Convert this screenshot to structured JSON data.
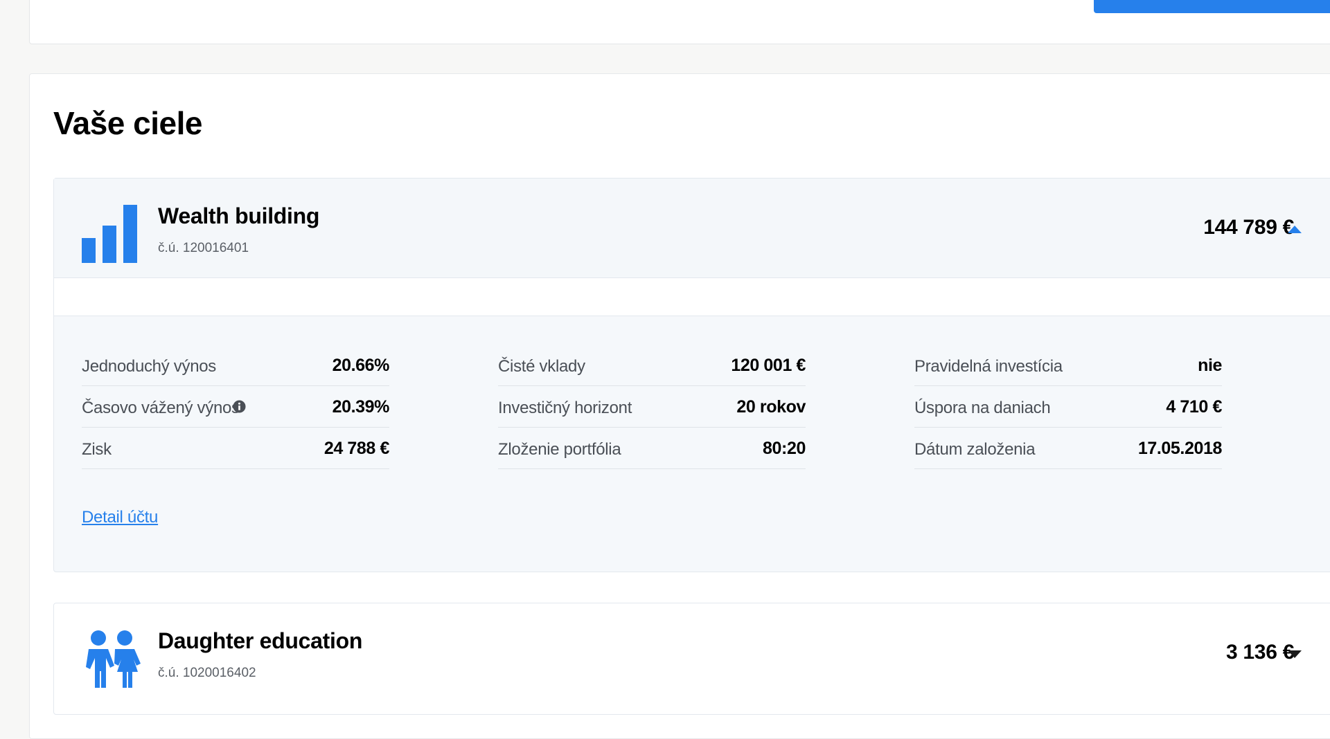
{
  "page": {
    "title": "Vaše ciele"
  },
  "colors": {
    "accent": "#2680eb",
    "background": "#f7f7f6",
    "panel": "#f5f8fb"
  },
  "goals": [
    {
      "name": "Wealth building",
      "account": "č.ú. 120016401",
      "amount": "144 789 €",
      "icon": "bar-chart-icon",
      "expanded": true,
      "toggle_icon": "triangle-up-icon",
      "stats": [
        [
          {
            "label": "Jednoduchý výnos",
            "value": "20.66%"
          },
          {
            "label": "Časovo vážený výnos",
            "value": "20.39%",
            "info_icon": "info-icon"
          },
          {
            "label": "Zisk",
            "value": "24 788 €"
          }
        ],
        [
          {
            "label": "Čisté vklady",
            "value": "120 001 €"
          },
          {
            "label": "Investičný horizont",
            "value": "20 rokov"
          },
          {
            "label": "Zloženie portfólia",
            "value": "80:20"
          }
        ],
        [
          {
            "label": "Pravidelná investícia",
            "value": "nie"
          },
          {
            "label": "Úspora na daniach",
            "value": "4 710 €"
          },
          {
            "label": "Dátum založenia",
            "value": "17.05.2018"
          }
        ]
      ],
      "detail_link": "Detail účtu"
    },
    {
      "name": "Daughter education",
      "account": "č.ú. 1020016402",
      "amount": "3 136 €",
      "icon": "children-icon",
      "expanded": false,
      "toggle_icon": "triangle-down-icon"
    }
  ]
}
